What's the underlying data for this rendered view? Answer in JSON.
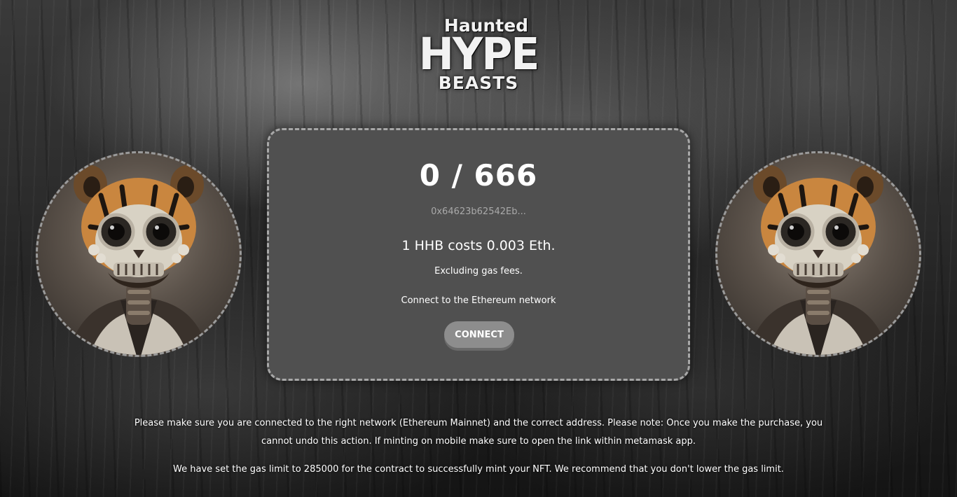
{
  "logo": {
    "line1": "Haunted",
    "line2": "HYPE",
    "line3": "BEASTS"
  },
  "mint": {
    "supply": "0 / 666",
    "contract_address": "0x64623b62542Eb...",
    "cost": "1 HHB costs 0.003 Eth.",
    "gas_note": "Excluding gas fees.",
    "network_note": "Connect to the Ethereum network",
    "connect_label": "CONNECT"
  },
  "info": {
    "paragraph1": "Please make sure you are connected to the right network (Ethereum Mainnet) and the correct address. Please note: Once you make the purchase, you cannot undo this action. If minting on mobile make sure to open the link within metamask app.",
    "paragraph2": "We have set the gas limit to 285000 for the contract to successfully mint your NFT. We recommend that you don't lower the gas limit."
  },
  "colors": {
    "card_bg": "#505050",
    "card_border": "#a8a8a8",
    "button_bg": "#8d8d8d",
    "contract_text": "#a9a9a9"
  },
  "icons": {
    "portrait": "tiger-skull-nft-portrait"
  }
}
